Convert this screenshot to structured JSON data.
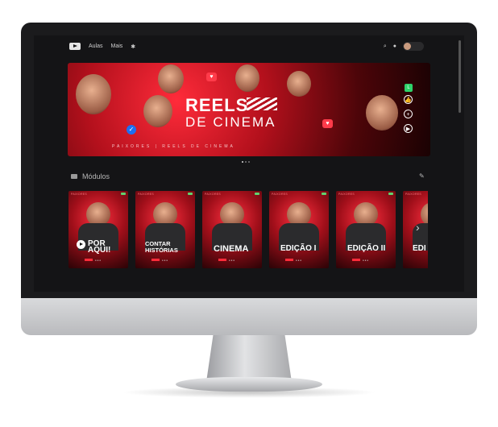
{
  "nav": {
    "links": [
      "Aulas",
      "Mais"
    ],
    "logo_icon": "play-logo-icon",
    "search_icon": "search-icon",
    "bell_icon": "bell-icon",
    "settings_icon": "gear-icon"
  },
  "banner": {
    "title_line1": "REELS",
    "title_line2": "DE CINEMA",
    "subline": "PAIXORES | REELS DE CINEMA",
    "live_badge": "L"
  },
  "modules": {
    "heading": "Módulos",
    "cards": [
      {
        "label": "POR AQUI!",
        "tag": "PAIXORES"
      },
      {
        "label": "CONTAR HISTÓRIAS",
        "tag": "PAIXORES"
      },
      {
        "label": "CINEMA",
        "tag": "PAIXORES"
      },
      {
        "label": "EDIÇÃO I",
        "tag": "PAIXORES"
      },
      {
        "label": "EDIÇÃO II",
        "tag": "PAIXORES"
      },
      {
        "label": "EDI",
        "tag": "PAIXORES"
      }
    ]
  },
  "colors": {
    "accent": "#e01a2a",
    "background": "#141416",
    "bezel": "#1b1b1d"
  }
}
